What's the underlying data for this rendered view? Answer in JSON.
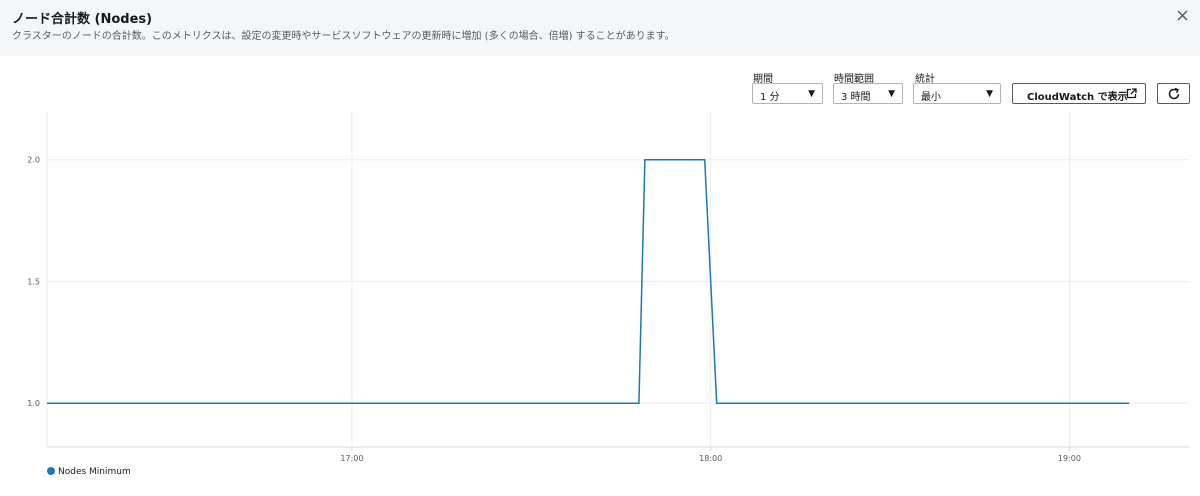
{
  "header": {
    "title": "ノード合計数 (Nodes)",
    "description": "クラスターのノードの合計数。このメトリクスは、設定の変更時やサービスソフトウェアの更新時に増加 (多くの場合、倍増) することがあります。"
  },
  "controls": {
    "period": {
      "label": "期間",
      "value": "1 分"
    },
    "time_range": {
      "label": "時間範囲",
      "value": "3 時間"
    },
    "statistic": {
      "label": "統計",
      "value": "最小"
    },
    "cloudwatch_button": "CloudWatch で表示",
    "icons": {
      "close": "close-icon",
      "external": "external-link-icon",
      "refresh": "refresh-icon",
      "caret": "caret-down-icon"
    }
  },
  "chart_data": {
    "type": "line",
    "x_ticks": [
      "17:00",
      "18:00",
      "19:00"
    ],
    "y_ticks": [
      "1.0",
      "1.5",
      "2.0"
    ],
    "ylim": [
      0.82,
      2.2
    ],
    "xlim": [
      "16:09",
      "19:20"
    ],
    "grid": true,
    "legend_position": "bottom-left",
    "series": [
      {
        "name": "Nodes Minimum",
        "color": "#1f77b4",
        "points": [
          [
            "16:09",
            1.0
          ],
          [
            "17:48",
            1.0
          ],
          [
            "17:49",
            2.0
          ],
          [
            "17:59",
            2.0
          ],
          [
            "18:01",
            1.0
          ],
          [
            "19:10",
            1.0
          ]
        ]
      }
    ]
  }
}
